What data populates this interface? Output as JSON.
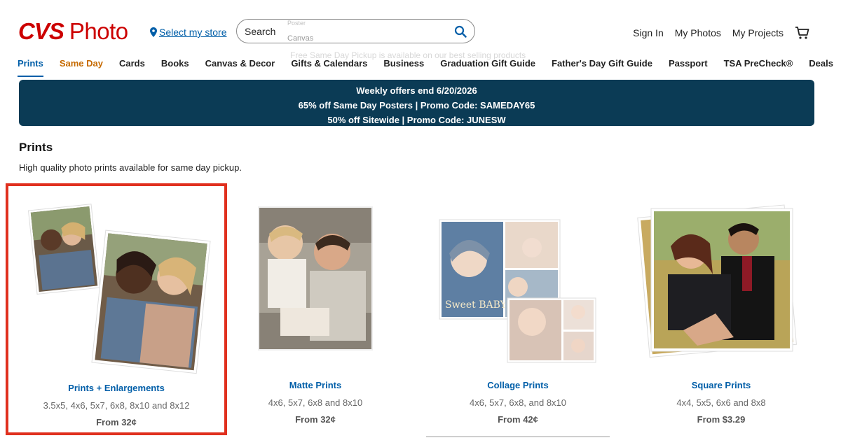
{
  "header": {
    "logo_cvs": "CVS",
    "logo_photo": "Photo",
    "store_link": "Select my store",
    "search_label": "Search",
    "search_ghost": "Canvas",
    "search_ghost_top": "Poster",
    "search_hint": "Free Same Day Pickup is available on our best selling products",
    "sign_in": "Sign In",
    "my_photos": "My Photos",
    "my_projects": "My Projects"
  },
  "nav": [
    "Prints",
    "Same Day",
    "Cards",
    "Books",
    "Canvas & Decor",
    "Gifts & Calendars",
    "Business",
    "Graduation Gift Guide",
    "Father's Day Gift Guide",
    "Passport",
    "TSA PreCheck®",
    "Deals"
  ],
  "banner": {
    "line1": "Weekly offers end 6/20/2026",
    "line2": "65% off Same Day Posters | Promo Code: SAMEDAY65",
    "line3": "50% off Sitewide | Promo Code: JUNESW"
  },
  "section": {
    "title": "Prints",
    "subtitle": "High quality photo prints available for same day pickup."
  },
  "products": [
    {
      "name": "Prints + Enlargements",
      "sizes": "3.5x5, 4x6, 5x7, 6x8, 8x10 and 8x12",
      "price": "From 32¢"
    },
    {
      "name": "Matte Prints",
      "sizes": "4x6, 5x7, 6x8 and 8x10",
      "price": "From 32¢"
    },
    {
      "name": "Collage Prints",
      "sizes": "4x6, 5x7, 6x8, and 8x10",
      "price": "From 42¢"
    },
    {
      "name": "Square Prints",
      "sizes": "4x4, 5x5, 6x6 and 8x8",
      "price": "From $3.29"
    }
  ],
  "collage_caption": "Sweet BABY BOY",
  "colors": {
    "brand_red": "#cc0000",
    "link_blue": "#005ea8",
    "banner_bg": "#0b3b55",
    "highlight_red": "#e0301e",
    "same_day_orange": "#c66a00"
  },
  "icons": [
    "location-pin-icon",
    "search-icon",
    "cart-icon"
  ]
}
